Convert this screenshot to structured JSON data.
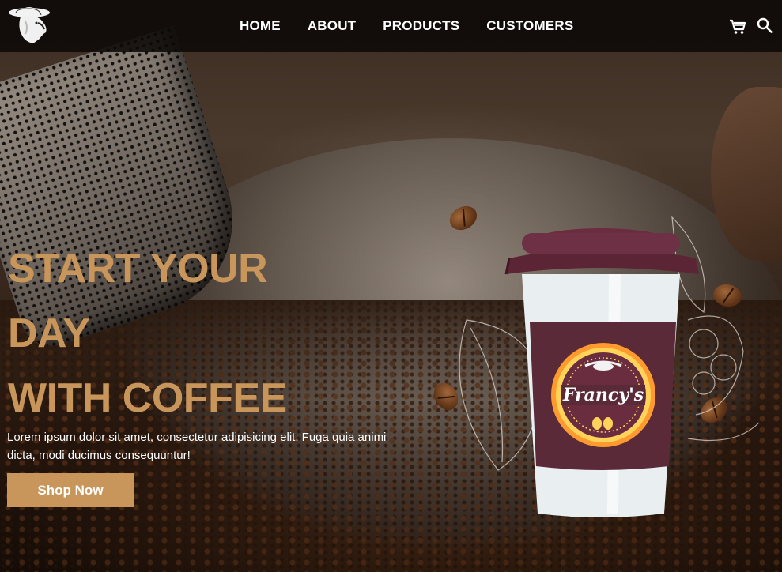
{
  "nav": {
    "logo_icon": "sombrero-head-logo-icon",
    "items": [
      {
        "label": "HOME"
      },
      {
        "label": "ABOUT"
      },
      {
        "label": "PRODUCTS"
      },
      {
        "label": "CUSTOMERS"
      }
    ],
    "cart_icon": "cart-icon",
    "search_icon": "search-icon"
  },
  "hero": {
    "headline_lines": [
      "START YOUR",
      "DAY",
      "WITH COFFEE"
    ],
    "description": "Lorem ipsum dolor sit amet, consectetur adipisicing elit. Fuga quia animi dicta, modi ducimus consequuntur!",
    "cta_label": "Shop Now",
    "cup_brand": "Francy's"
  },
  "colors": {
    "accent": "#c8955a",
    "navbar": "#0c0907",
    "cup_sleeve": "#5a2a38",
    "cup_lid": "#5c2536",
    "badge_ring": "#ff9b2e"
  }
}
